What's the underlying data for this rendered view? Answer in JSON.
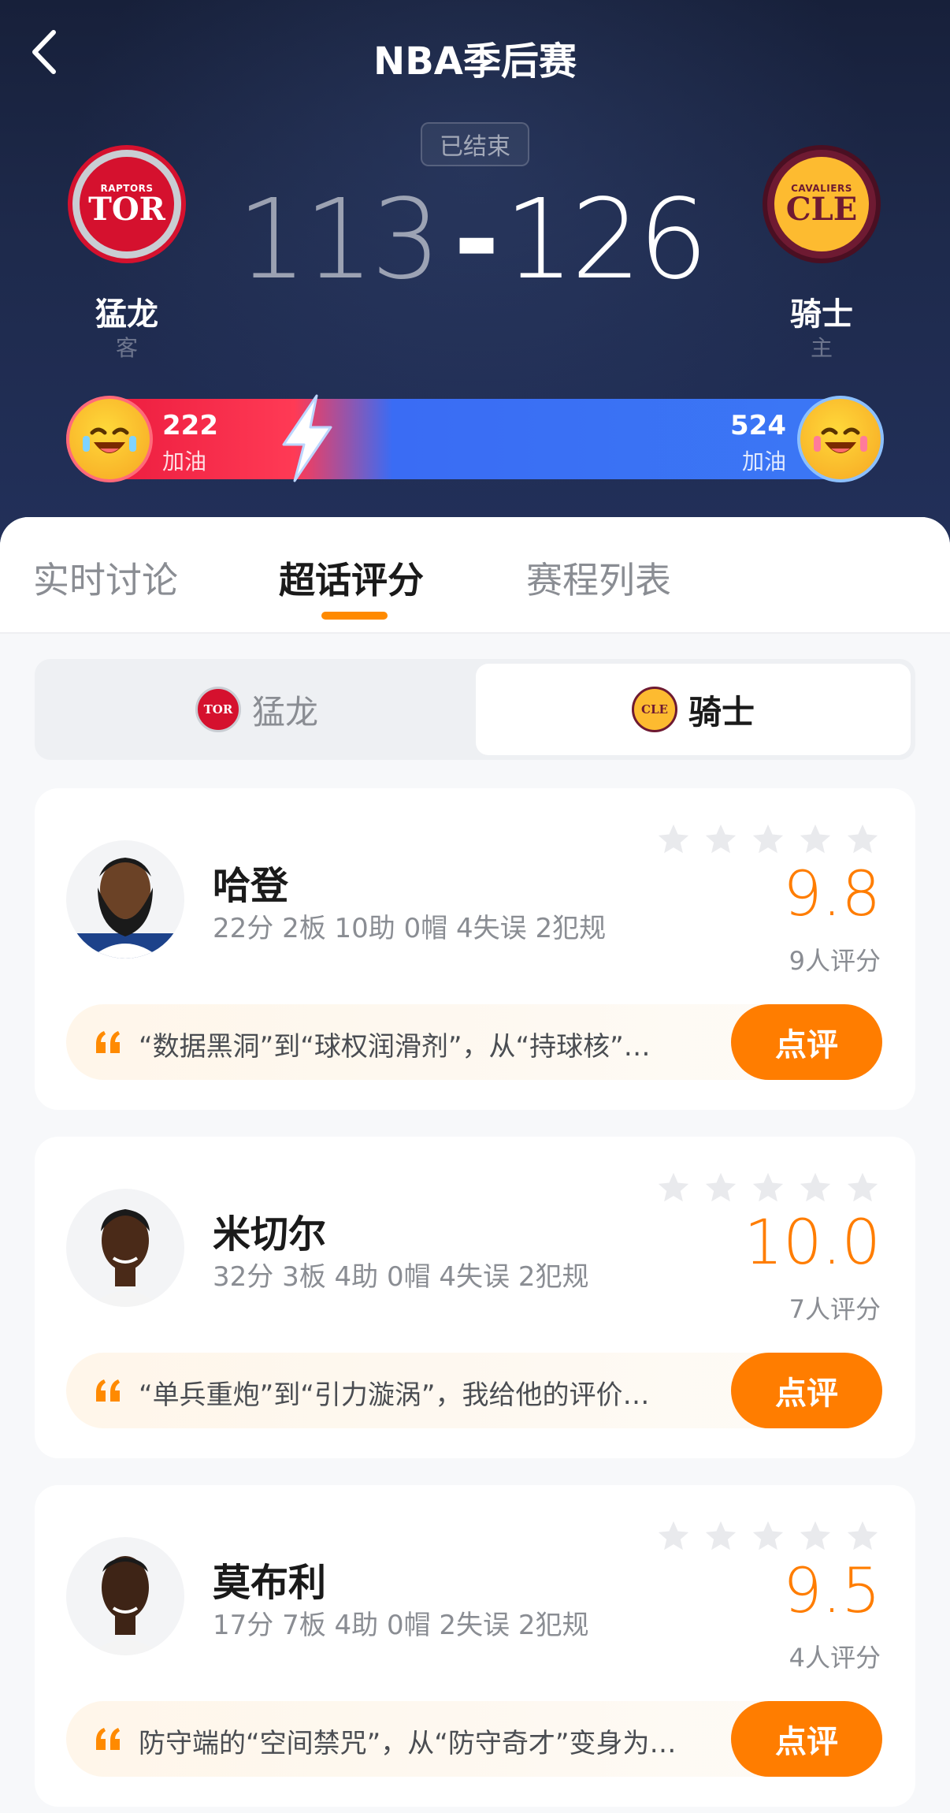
{
  "header": {
    "title": "NBA季后赛",
    "status": "已结束",
    "away": {
      "abbr": "TOR",
      "logo_text": "RAPTORS",
      "name": "猛龙",
      "role": "客",
      "score": "113"
    },
    "home": {
      "abbr": "CLE",
      "logo_text": "CAVALIERS",
      "name": "骑士",
      "role": "主",
      "score": "126"
    },
    "score_separator": "-",
    "colors": {
      "away": "#d5112e",
      "home": "#3b78f5",
      "accent": "#ff7d00"
    }
  },
  "cheer": {
    "away": {
      "count": "222",
      "label": "加油"
    },
    "home": {
      "count": "524",
      "label": "加油"
    }
  },
  "tabs": [
    {
      "label": "实时讨论"
    },
    {
      "label": "超话评分"
    },
    {
      "label": "赛程列表"
    }
  ],
  "active_tab": "超话评分",
  "team_switch": {
    "away": {
      "name": "猛龙",
      "abbr": "TOR"
    },
    "home": {
      "name": "骑士",
      "abbr": "CLE"
    },
    "selected": "骑士"
  },
  "players": [
    {
      "name": "哈登",
      "stats": "22分 2板 10助 0帽 4失误 2犯规",
      "rating": "9.8",
      "rating_count": "9人评分",
      "comment": "“数据黑洞”到“球权润滑剂”，从“持球核”…",
      "button": "点评"
    },
    {
      "name": "米切尔",
      "stats": "32分 3板 4助 0帽 4失误 2犯规",
      "rating": "10.0",
      "rating_count": "7人评分",
      "comment": "“单兵重炮”到“引力漩涡”，我给他的评价…",
      "button": "点评"
    },
    {
      "name": "莫布利",
      "stats": "17分 7板 4助 0帽 2失误 2犯规",
      "rating": "9.5",
      "rating_count": "4人评分",
      "comment": "防守端的“空间禁咒”，从“防守奇才”变身为…",
      "button": "点评"
    }
  ]
}
